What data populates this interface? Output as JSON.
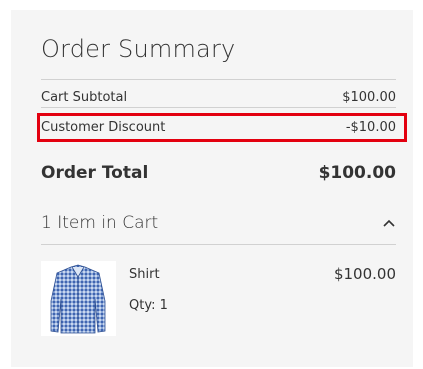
{
  "summary": {
    "title": "Order Summary",
    "subtotal_label": "Cart Subtotal",
    "subtotal_value": "$100.00",
    "discount_label": "Customer Discount",
    "discount_value": "-$10.00",
    "total_label": "Order Total",
    "total_value": "$100.00"
  },
  "cart": {
    "items_count_label": "1 Item in Cart",
    "toggle_icon": "chevron-up-icon",
    "items": [
      {
        "name": "Shirt",
        "qty_label": "Qty: 1",
        "price": "$100.00",
        "image_icon": "shirt-thumbnail"
      }
    ]
  },
  "colors": {
    "panel_bg": "#f5f5f5",
    "highlight_border": "#e3000f",
    "text": "#333333"
  }
}
